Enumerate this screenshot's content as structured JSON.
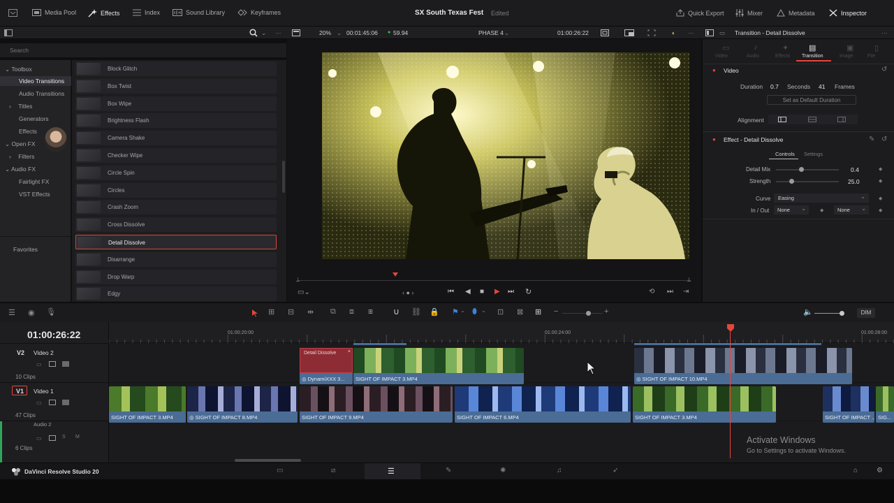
{
  "topbar": {
    "media_pool": "Media Pool",
    "effects": "Effects",
    "index": "Index",
    "sound_library": "Sound Library",
    "keyframes": "Keyframes",
    "project_title": "SX South Texas Fest",
    "project_status": "Edited",
    "quick_export": "Quick Export",
    "mixer": "Mixer",
    "metadata": "Metadata",
    "inspector": "Inspector"
  },
  "viewer_bar": {
    "zoom": "20%",
    "timecode_left": "00:01:45:06",
    "fps": "59.94",
    "timeline_name": "PHASE 4",
    "timecode_right": "01:00:26:22"
  },
  "search": {
    "placeholder": "Search"
  },
  "sidebar": {
    "items": [
      {
        "label": "Toolbox"
      },
      {
        "label": "Video Transitions"
      },
      {
        "label": "Audio Transitions"
      },
      {
        "label": "Titles"
      },
      {
        "label": "Generators"
      },
      {
        "label": "Effects"
      },
      {
        "label": "Open FX"
      },
      {
        "label": "Filters"
      },
      {
        "label": "Audio FX"
      },
      {
        "label": "Fairlight FX"
      },
      {
        "label": "VST Effects"
      }
    ],
    "favorites": "Favorites"
  },
  "effects_list": [
    "Block Glitch",
    "Box Twist",
    "Box Wipe",
    "Brightness Flash",
    "Camera Shake",
    "Checker Wipe",
    "Circle Spin",
    "Circles",
    "Crash Zoom",
    "Cross Dissolve",
    "Detail Dissolve",
    "Disarrange",
    "Drop Warp",
    "Edgy"
  ],
  "selected_effect": "Detail Dissolve",
  "inspector": {
    "title": "Transition - Detail Dissolve",
    "tabs": [
      "Video",
      "Audio",
      "Effects",
      "Transition",
      "Image",
      "File"
    ],
    "active_tab": "Transition",
    "section_video": "Video",
    "duration_label": "Duration",
    "duration_seconds": "0.7",
    "seconds_label": "Seconds",
    "duration_frames": "41",
    "frames_label": "Frames",
    "set_default": "Set as Default Duration",
    "alignment_label": "Alignment",
    "effect_section": "Effect - Detail Dissolve",
    "subtabs": [
      "Controls",
      "Settings"
    ],
    "detail_mix_label": "Detail Mix",
    "detail_mix_value": "0.4",
    "detail_mix_fraction": 0.4,
    "strength_label": "Strength",
    "strength_value": "25.0",
    "strength_fraction": 0.25,
    "curve_label": "Curve",
    "curve_value": "Easing",
    "inout_label": "In / Out",
    "in_value": "None",
    "out_value": "None"
  },
  "timeline": {
    "timecode": "01:00:26:22",
    "ruler_marks": [
      "01:00:20:00",
      "01:00:24:00",
      "01:00:28:00"
    ],
    "tracks": [
      {
        "id": "V2",
        "name": "Video 2",
        "clips": "10 Clips"
      },
      {
        "id": "V1",
        "name": "Video 1",
        "clips": "47 Clips"
      },
      {
        "id": "A2",
        "name": "Audio 2",
        "clips": "6 Clips"
      }
    ],
    "v2_clips": [
      {
        "label": "Detail Dissolve"
      },
      {
        "label": "DynamiXXX 3..."
      },
      {
        "label": "SIGHT OF IMPACT 3.MP4"
      },
      {
        "label": "SIGHT OF IMPACT 10.MP4"
      }
    ],
    "v1_clips": [
      {
        "label": "SIGHT OF IMPACT 3.MP4"
      },
      {
        "label": "SIGHT OF IMPACT 8.MP4"
      },
      {
        "label": "SIGHT OF IMPACT 9.MP4"
      },
      {
        "label": "SIGHT OF IMPACT 6.MP4"
      },
      {
        "label": "SIGHT OF IMPACT 3.MP4"
      },
      {
        "label": "SIGHT OF IMPACT ..."
      },
      {
        "label": "SIG..."
      }
    ],
    "dim_label": "DIM"
  },
  "watermark": {
    "title": "Activate Windows",
    "subtitle": "Go to Settings to activate Windows."
  },
  "statusbar": {
    "app_name": "DaVinci Resolve Studio 20"
  },
  "colors": {
    "accent_red": "#e5463b",
    "clip_blue": "#4a6c95",
    "playhead": "#e5463b"
  }
}
